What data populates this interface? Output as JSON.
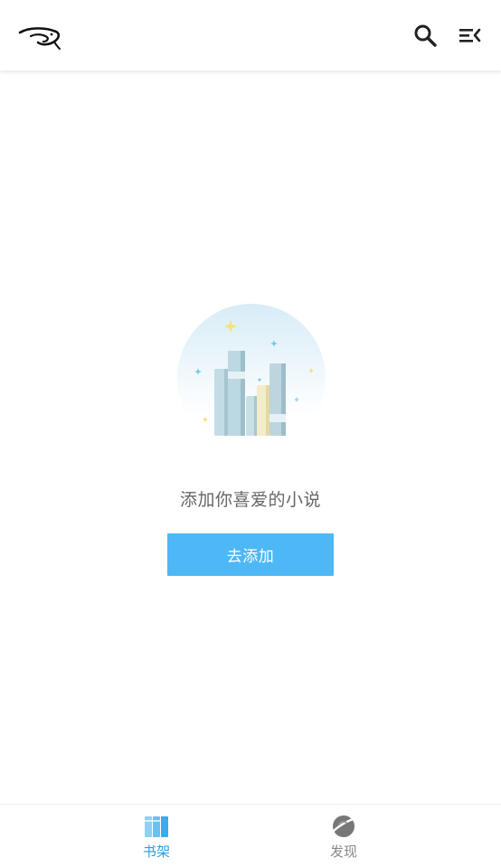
{
  "header": {
    "logo_icon": "bird-logo-icon",
    "search_icon": "search-icon",
    "menu_icon": "menu-collapse-icon"
  },
  "empty_state": {
    "illustration": "books-illustration",
    "message": "添加你喜爱的小说",
    "button_label": "去添加"
  },
  "bottom_nav": {
    "items": [
      {
        "label": "书架",
        "icon": "bookshelf-icon",
        "active": true
      },
      {
        "label": "发现",
        "icon": "planet-icon",
        "active": false
      }
    ]
  },
  "colors": {
    "accent": "#4db8f5",
    "active_tab": "#2b9de0",
    "inactive_tab": "#888888"
  }
}
